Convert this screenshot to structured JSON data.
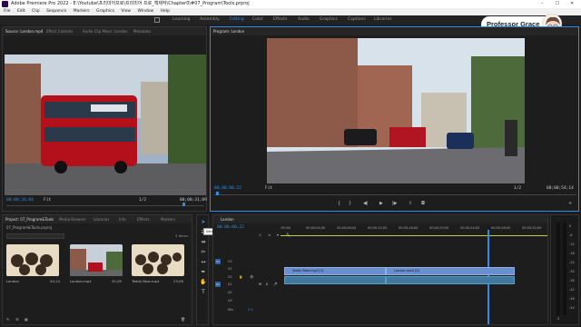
{
  "window": {
    "title": "Adobe Premiere Pro 2022 - E:\\Youtube\\프리미어프로\\프리미어 프로_책제작\\Chapter0\\#07_Program\\Tools.prproj",
    "minimize": "–",
    "maximize": "☐",
    "close": "✕"
  },
  "menu": [
    "File",
    "Edit",
    "Clip",
    "Sequence",
    "Markers",
    "Graphics",
    "View",
    "Window",
    "Help"
  ],
  "workspaces": [
    {
      "label": "Learning",
      "active": false
    },
    {
      "label": "Assembly",
      "active": false
    },
    {
      "label": "Editing",
      "active": true
    },
    {
      "label": "Color",
      "active": false
    },
    {
      "label": "Effects",
      "active": false
    },
    {
      "label": "Audio",
      "active": false
    },
    {
      "label": "Graphics",
      "active": false
    },
    {
      "label": "Captions",
      "active": false
    },
    {
      "label": "Libraries",
      "active": false
    }
  ],
  "badge": {
    "name": "Professor Grace"
  },
  "source": {
    "tabs": [
      "Source: London.mp4",
      "Effect Controls",
      "Audio Clip Mixer: London",
      "Metadata"
    ],
    "timecode_left": "00;00;26;04",
    "fit": "Fit",
    "scale": "1/2",
    "timecode_right": "00;00;31;09"
  },
  "program": {
    "tabs": [
      "Program: London"
    ],
    "timecode_left": "00;00;00;22",
    "fit": "Fit",
    "scale": "1/2",
    "timecode_right": "00;00;54;14"
  },
  "project": {
    "tabs": [
      "Project: 07_Program&Tools",
      "Media Browser",
      "Libraries",
      "Info",
      "Effects",
      "Markers"
    ],
    "path": "07_Program&Tools.prproj",
    "items_count": "3 items",
    "items": [
      {
        "name": "London",
        "duration": "54;14"
      },
      {
        "name": "London.mp4",
        "duration": "31;09"
      },
      {
        "name": "Teddy Bear.mp4",
        "duration": "23;08"
      }
    ]
  },
  "tooltip": "Selection Tool (V)",
  "timeline": {
    "tab": "London",
    "timecode": "00;00;00;22",
    "ruler": [
      ":00;00",
      "00;00;04;00",
      "00;00;08;00",
      "00;00;12;00",
      "00;00;16;00",
      "00;00;20;00",
      "00;00;24;00",
      "00;00;28;00",
      "00;00;32;00"
    ],
    "video_tracks": [
      "V3",
      "V2",
      "V1"
    ],
    "audio_tracks": [
      "A1",
      "A2",
      "A3"
    ],
    "mix_label": "Mix",
    "mix_value": "0.0",
    "clips": [
      {
        "name": "Teddy Bear.mp4 [V]"
      },
      {
        "name": "London.mp4 [V]"
      }
    ]
  },
  "meters": {
    "labels": [
      "0",
      "-6",
      "-12",
      "-18",
      "-24",
      "-30",
      "-36",
      "-42",
      "-48",
      "-54"
    ],
    "solo": "S"
  }
}
